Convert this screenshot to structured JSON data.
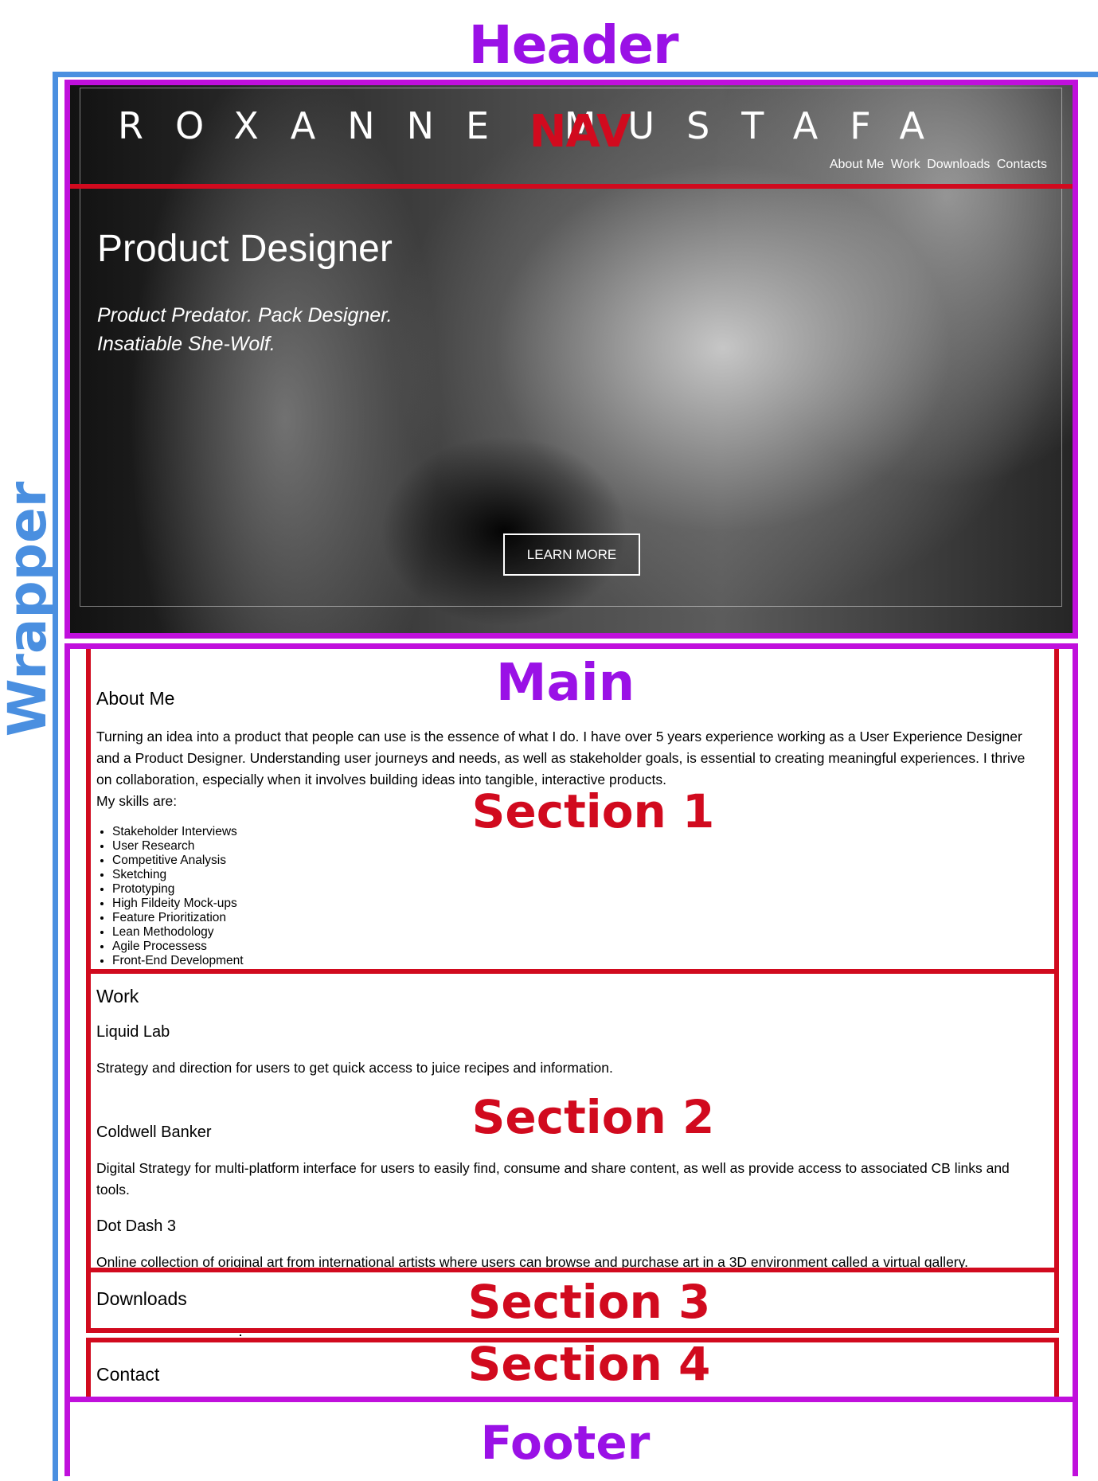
{
  "labels": {
    "header": "Header",
    "nav": "NAV",
    "wrapper": "Wrapper",
    "main": "Main",
    "section1": "Section 1",
    "section2": "Section 2",
    "section3": "Section 3",
    "section4": "Section 4",
    "footer": "Footer"
  },
  "colors": {
    "wrapper": "#4a8fe0",
    "header_main_footer": "#c010dc",
    "nav_sections": "#d10a1e"
  },
  "header": {
    "brand": "ROXANNE MUSTAFA",
    "nav": [
      "About Me",
      "Work",
      "Downloads",
      "Contacts"
    ],
    "hero_title": "Product Designer",
    "tagline_line1": "Product Predator. Pack Designer.",
    "tagline_line2": "Insatiable She-Wolf.",
    "cta": "LEARN MORE"
  },
  "about": {
    "heading": "About Me",
    "paragraph": "Turning an idea into a product that people can use is the essence of what I do. I have over 5 years experience working as a User Experience Designer and a Product Designer. Understanding user journeys and needs, as well as stakeholder goals, is essential to creating meaningful experiences. I thrive on collaboration, especially when it involves building ideas into tangible, interactive products.",
    "skills_intro": "My skills are:",
    "skills": [
      "Stakeholder Interviews",
      "User Research",
      "Competitive Analysis",
      "Sketching",
      "Prototyping",
      "High Fildeity Mock-ups",
      "Feature Prioritization",
      "Lean Methodology",
      "Agile Processess",
      "Front-End Development"
    ]
  },
  "work": {
    "heading": "Work",
    "projects": [
      {
        "name": "Liquid Lab",
        "desc": "Strategy and direction for users to get quick access to juice recipes and information."
      },
      {
        "name": "Coldwell Banker",
        "desc": "Digital Strategy for multi-platform interface for users to easily find, consume and share content, as well as provide access to associated CB links and tools."
      },
      {
        "name": "Dot Dash 3",
        "desc": "Online collection of original art from international artists where users can browse and purchase art in a 3D environment called a virtual gallery."
      }
    ]
  },
  "downloads": {
    "heading": "Downloads"
  },
  "contact": {
    "heading": "Contact"
  }
}
